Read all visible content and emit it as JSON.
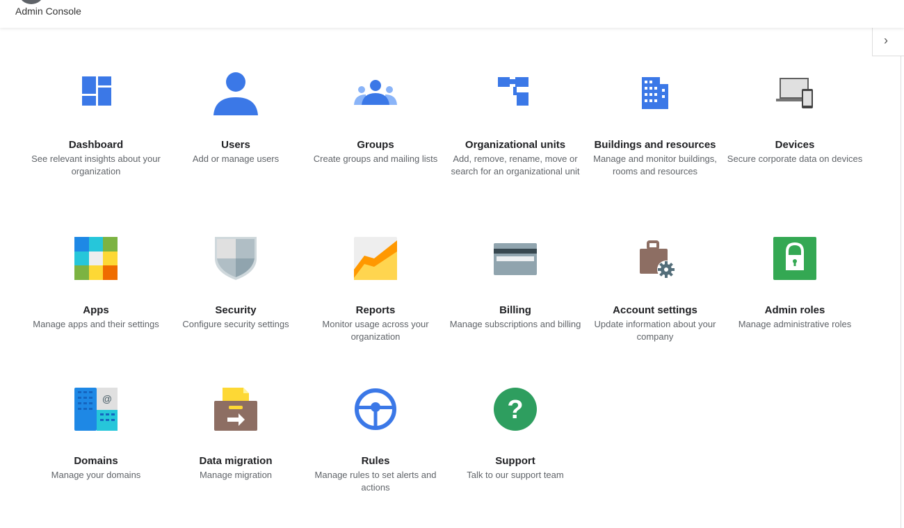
{
  "header": {
    "title": "Admin Console"
  },
  "side_panel": {
    "toggle_icon": "chevron-right-icon",
    "toggle_glyph": "›"
  },
  "tiles": [
    {
      "key": "dashboard",
      "title": "Dashboard",
      "desc": "See relevant insights about your organization",
      "icon": "dashboard-icon",
      "color": "#3b78e7"
    },
    {
      "key": "users",
      "title": "Users",
      "desc": "Add or manage users",
      "icon": "user-icon",
      "color": "#3b78e7"
    },
    {
      "key": "groups",
      "title": "Groups",
      "desc": "Create groups and mailing lists",
      "icon": "groups-icon",
      "color": "#3b78e7"
    },
    {
      "key": "org-units",
      "title": "Organizational units",
      "desc": "Add, remove, rename, move or search for an organizational unit",
      "icon": "org-tree-icon",
      "color": "#3b78e7"
    },
    {
      "key": "buildings",
      "title": "Buildings and resources",
      "desc": "Manage and monitor buildings, rooms and resources",
      "icon": "building-icon",
      "color": "#3b78e7"
    },
    {
      "key": "devices",
      "title": "Devices",
      "desc": "Secure corporate data on devices",
      "icon": "devices-icon",
      "color": "#757575"
    },
    {
      "key": "apps",
      "title": "Apps",
      "desc": "Manage apps and their settings",
      "icon": "apps-grid-icon",
      "color": ""
    },
    {
      "key": "security",
      "title": "Security",
      "desc": "Configure security settings",
      "icon": "shield-icon",
      "color": "#90a4ae"
    },
    {
      "key": "reports",
      "title": "Reports",
      "desc": "Monitor usage across your organization",
      "icon": "reports-chart-icon",
      "color": "#f9a825"
    },
    {
      "key": "billing",
      "title": "Billing",
      "desc": "Manage subscriptions and billing",
      "icon": "credit-card-icon",
      "color": "#90a4ae"
    },
    {
      "key": "account-settings",
      "title": "Account settings",
      "desc": "Update information about your company",
      "icon": "briefcase-gear-icon",
      "color": "#8d6e63"
    },
    {
      "key": "admin-roles",
      "title": "Admin roles",
      "desc": "Manage administrative roles",
      "icon": "lock-icon",
      "color": "#34a853"
    },
    {
      "key": "domains",
      "title": "Domains",
      "desc": "Manage your domains",
      "icon": "domains-icon",
      "color": "#1e88e5"
    },
    {
      "key": "data-migration",
      "title": "Data migration",
      "desc": "Manage migration",
      "icon": "migration-box-icon",
      "color": "#8d6e63"
    },
    {
      "key": "rules",
      "title": "Rules",
      "desc": "Manage rules to set alerts and actions",
      "icon": "steering-wheel-icon",
      "color": "#3b78e7"
    },
    {
      "key": "support",
      "title": "Support",
      "desc": "Talk to our support team",
      "icon": "help-circle-icon",
      "color": "#34a853"
    }
  ]
}
